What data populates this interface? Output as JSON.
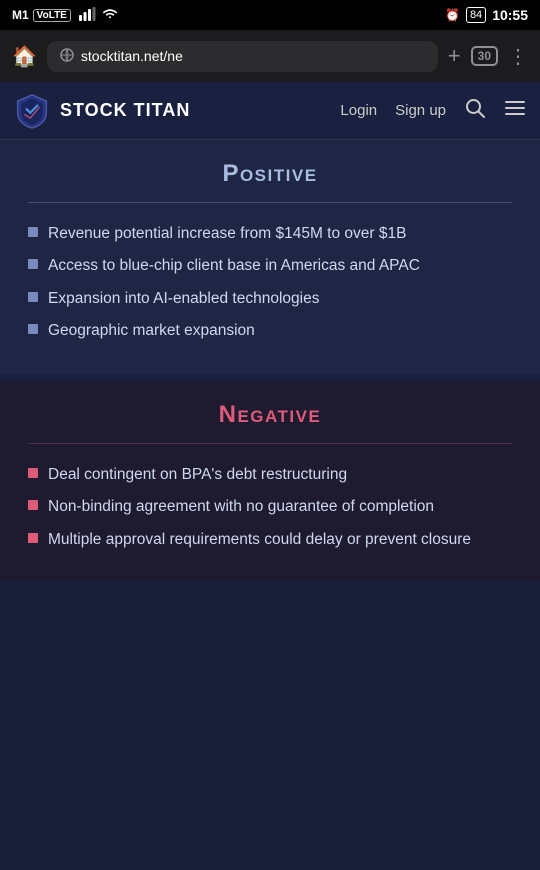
{
  "statusBar": {
    "carrier": "M1",
    "carrierBadge": "VoLTE",
    "time": "10:55",
    "batteryPercent": "84",
    "alarmIcon": "⏰"
  },
  "browser": {
    "url": "stocktitan.net/ne",
    "tabCount": "30",
    "homeIcon": "⌂",
    "addIcon": "+",
    "moreIcon": "⋮"
  },
  "navbar": {
    "logoText": "STOCK TITAN",
    "loginLabel": "Login",
    "signupLabel": "Sign up"
  },
  "positive": {
    "title": "Positive",
    "items": [
      "Revenue potential increase from $145M to over $1B",
      "Access to blue-chip client base in Americas and APAC",
      "Expansion into AI-enabled technologies",
      "Geographic market expansion"
    ]
  },
  "negative": {
    "title": "Negative",
    "items": [
      "Deal contingent on BPA's debt restructuring",
      "Non-binding agreement with no guarantee of completion",
      "Multiple approval requirements could delay or prevent closure"
    ]
  }
}
